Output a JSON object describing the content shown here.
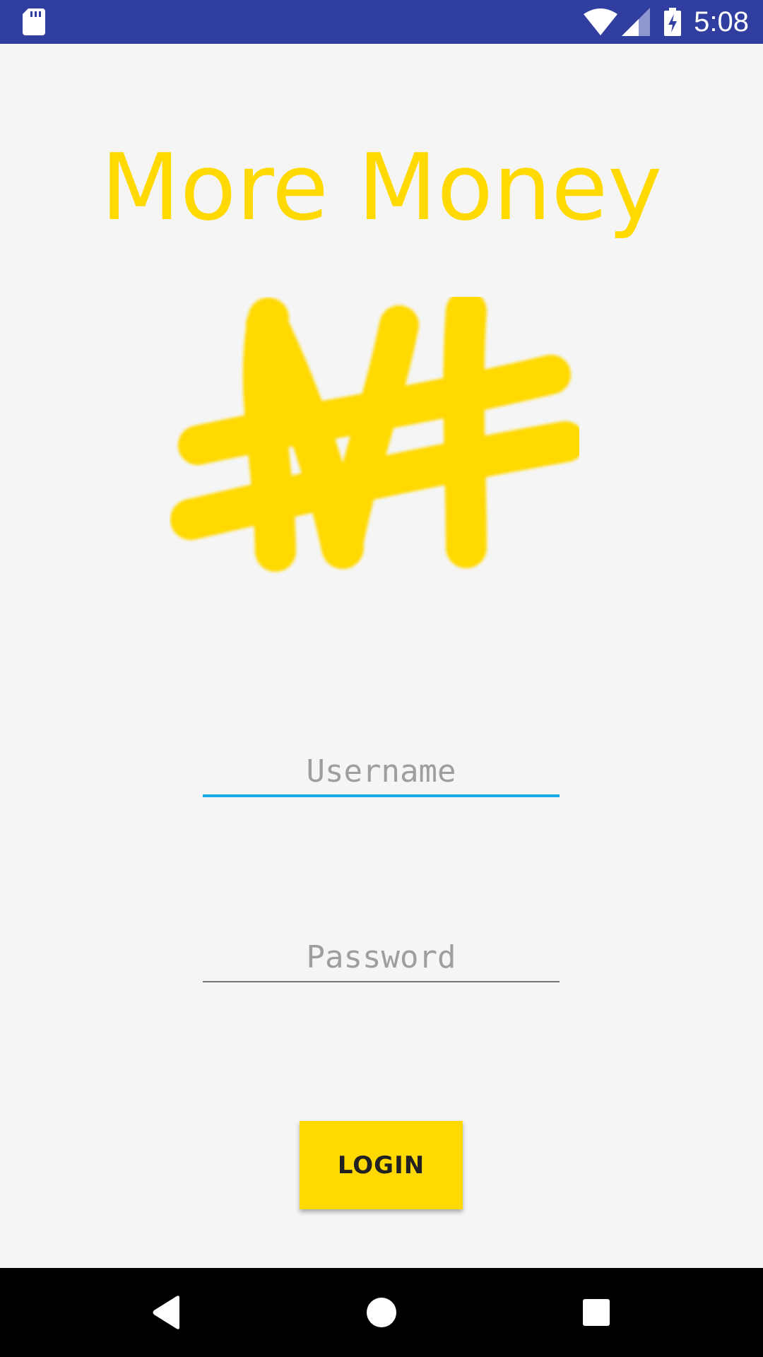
{
  "status_bar": {
    "time": "5:08",
    "background": "#303f9f",
    "icons": [
      "sd-card-icon",
      "wifi-icon",
      "signal-icon",
      "battery-charging-icon"
    ]
  },
  "app": {
    "title": "More Money",
    "logo_icon": "naira-currency-icon",
    "accent_color": "#ffd900"
  },
  "login_form": {
    "username_placeholder": "Username",
    "username_value": "",
    "password_placeholder": "Password",
    "password_value": "",
    "login_label": "LOGIN"
  },
  "nav_bar": {
    "icons": [
      "back-icon",
      "home-icon",
      "recents-icon"
    ]
  }
}
